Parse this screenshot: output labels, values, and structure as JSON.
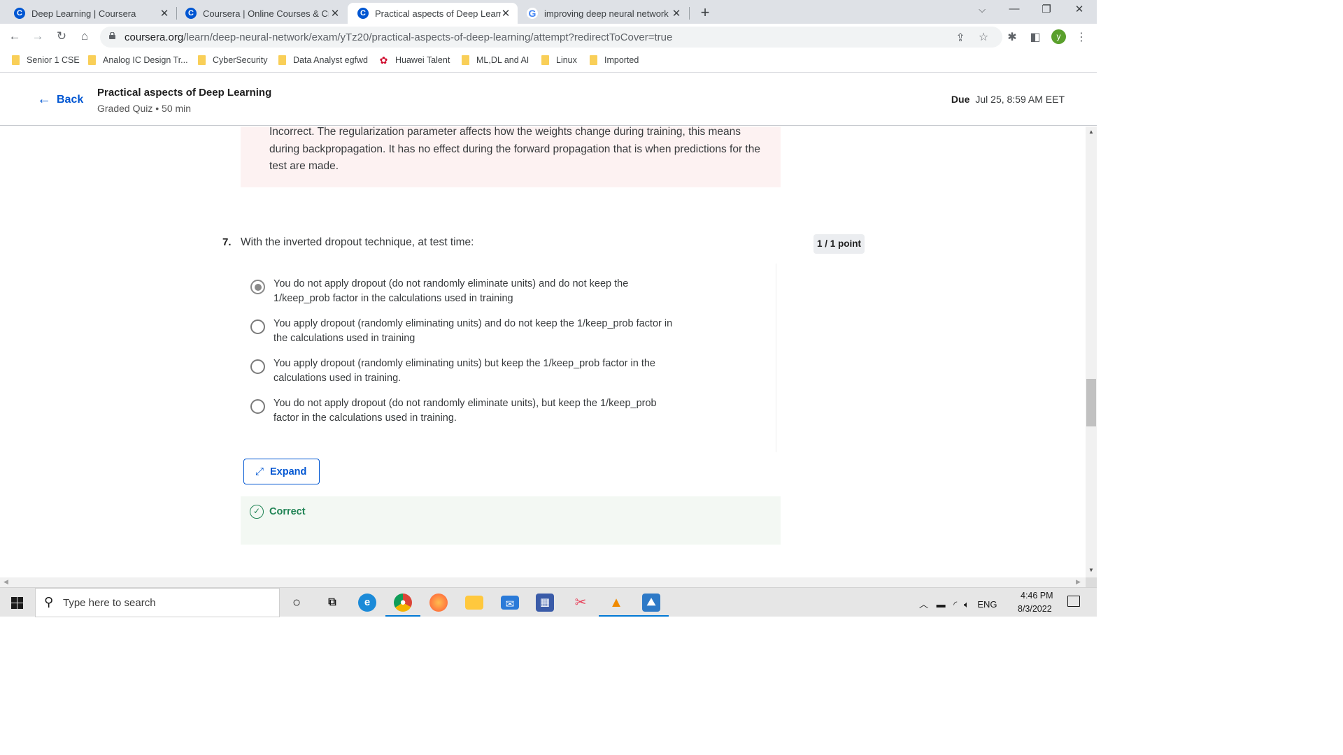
{
  "browser": {
    "tabs": [
      {
        "title": "Deep Learning | Coursera",
        "favicon": "coursera-icon",
        "active": false
      },
      {
        "title": "Coursera | Online Courses & Credentials From Top Educators",
        "favicon": "coursera-icon",
        "active": false
      },
      {
        "title": "Practical aspects of Deep Learning",
        "favicon": "coursera-icon",
        "active": true
      },
      {
        "title": "improving deep neural networks",
        "favicon": "google-icon",
        "active": false
      }
    ],
    "url_host": "coursera.org",
    "url_path": "/learn/deep-neural-network/exam/yTz20/practical-aspects-of-deep-learning/attempt?redirectToCover=true",
    "profile_initial": "y",
    "bookmarks": [
      "Senior 1 CSE",
      "Analog IC Design Tr...",
      "CyberSecurity",
      "Data Analyst egfwd",
      "Huawei Talent",
      "ML,DL and AI",
      "Linux",
      "Imported"
    ]
  },
  "header": {
    "back_label": "Back",
    "title": "Practical aspects of Deep Learning",
    "subtitle": "Graded Quiz • 50 min",
    "due_label": "Due",
    "due_value": "Jul 25, 8:59 AM EET"
  },
  "previous_feedback": {
    "text": "Incorrect. The regularization parameter affects how the weights change during training, this means during backpropagation. It has no effect during the forward propagation that is when predictions for the test are made."
  },
  "question": {
    "number": "7.",
    "text": "With the inverted dropout technique, at test time:",
    "points": "1 / 1 point",
    "options": [
      {
        "label": "You do not apply dropout (do not randomly eliminate units) and do not keep the 1/keep_prob factor in the calculations used in training",
        "selected": true
      },
      {
        "label": "You apply dropout (randomly eliminating units) and do not keep the 1/keep_prob factor in the calculations used in training",
        "selected": false
      },
      {
        "label": "You apply dropout (randomly eliminating units) but keep the 1/keep_prob factor in the calculations used in training.",
        "selected": false
      },
      {
        "label": "You do not apply dropout (do not randomly eliminate units), but keep the 1/keep_prob factor in the calculations used in training.",
        "selected": false
      }
    ],
    "expand_label": "Expand",
    "feedback_label": "Correct"
  },
  "taskbar": {
    "search_placeholder": "Type here to search",
    "language": "ENG",
    "time": "4:46 PM",
    "date": "8/3/2022"
  },
  "colors": {
    "accent": "#0056d2",
    "correct": "#1f8354",
    "incorrect_bg": "#fdf2f2",
    "correct_bg": "#f3f8f3"
  }
}
